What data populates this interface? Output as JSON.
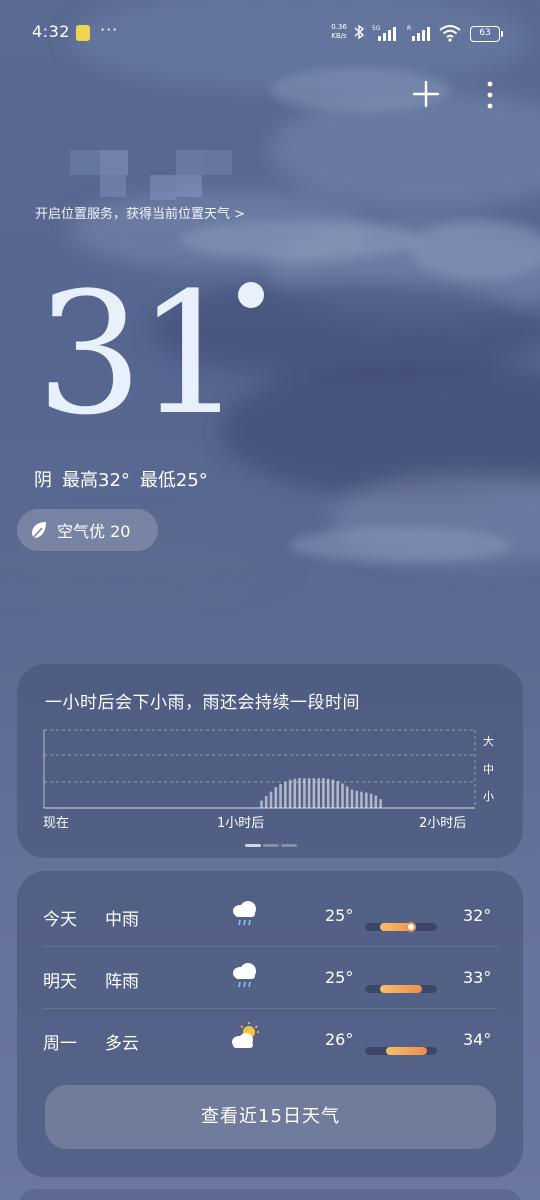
{
  "status_bar": {
    "time": "4:32",
    "notif_icon": "notification-app-icon",
    "overflow": "···",
    "net_speed_value": "0.36",
    "net_speed_unit": "KB/s",
    "battery": "63"
  },
  "actions": {
    "add_icon": "plus-icon",
    "more_icon": "more-vertical-icon"
  },
  "location": {
    "hint": "开启位置服务，获得当前位置天气 >"
  },
  "current": {
    "temperature": "31",
    "condition": "阴",
    "high": "最高32°",
    "low": "最低25°",
    "aqi": "空气优 20",
    "aqi_icon": "leaf-icon"
  },
  "rain_card": {
    "title": "一小时后会下小雨，雨还会持续一段时间",
    "y_labels": [
      "大",
      "中",
      "小"
    ],
    "x_labels": [
      "现在",
      "1小时后",
      "2小时后"
    ],
    "chart_data": {
      "type": "bar",
      "title": "一小时后会下小雨，雨还会持续一段时间",
      "xlabel": "",
      "ylabel": "",
      "categories": [
        "现在",
        "1小时后",
        "2小时后"
      ],
      "y_levels": [
        "小",
        "中",
        "大"
      ],
      "ylim": [
        0,
        3
      ],
      "grid": true,
      "series": [
        {
          "values": [
            0,
            0,
            0,
            0,
            0,
            0,
            0,
            0,
            0,
            0,
            0,
            0,
            0,
            0,
            0,
            0,
            0,
            0,
            0,
            0,
            0,
            0,
            0,
            0,
            0,
            0,
            0,
            0,
            0,
            0,
            0,
            0,
            0,
            0,
            0,
            0,
            0,
            0,
            0,
            0,
            0,
            0,
            0,
            0,
            0,
            0.25,
            0.4,
            0.55,
            0.7,
            0.8,
            0.88,
            0.95,
            0.98,
            1.0,
            1.0,
            1.0,
            1.0,
            1.0,
            1.0,
            0.98,
            0.95,
            0.9,
            0.82,
            0.72,
            0.62,
            0.58,
            0.55,
            0.52,
            0.48,
            0.42,
            0.3,
            0,
            0,
            0,
            0,
            0,
            0,
            0,
            0,
            0,
            0,
            0,
            0,
            0,
            0,
            0,
            0,
            0,
            0,
            0
          ]
        }
      ]
    }
  },
  "forecast": [
    {
      "day": "今天",
      "condition": "中雨",
      "icon": "cloud-rain-icon",
      "low": "25°",
      "high": "32°",
      "low_value": 25,
      "high_value": 32,
      "current_value": 31
    },
    {
      "day": "明天",
      "condition": "阵雨",
      "icon": "cloud-rain-icon",
      "low": "25°",
      "high": "33°",
      "low_value": 25,
      "high_value": 33
    },
    {
      "day": "周一",
      "condition": "多云",
      "icon": "partly-cloudy-icon",
      "low": "26°",
      "high": "34°",
      "low_value": 26,
      "high_value": 34
    }
  ],
  "forecast_range": {
    "min": 22,
    "max": 36
  },
  "view_15_day": "查看近15日天气"
}
